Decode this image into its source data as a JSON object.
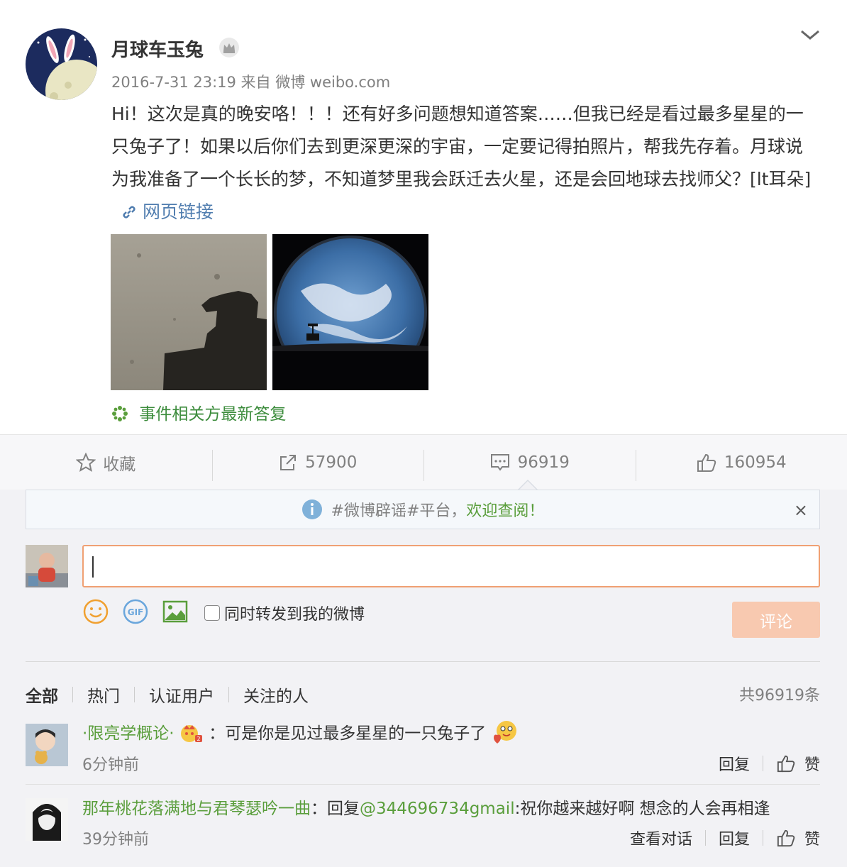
{
  "post": {
    "author": "月球车玉兔",
    "meta": "2016-7-31 23:19 来自 微博 weibo.com",
    "text": "Hi！这次是真的晚安咯！！！还有好多问题想知道答案……但我已经是看过最多星星的一只兔子了！如果以后你们去到更深更深的宇宙，一定要记得拍照片，帮我先存着。月球说为我准备了一个长长的梦，不知道梦里我会跃迁去火星，还是会回地球去找师父？[lt耳朵]",
    "link_label": "网页链接",
    "event_label": "事件相关方最新答复"
  },
  "actions": {
    "favorite": "收藏",
    "repost": "57900",
    "comment": "96919",
    "like": "160954"
  },
  "notice": {
    "head": "#微博辟谣#平台，",
    "tail": "欢迎查阅！",
    "close": "×"
  },
  "compose": {
    "sync_label": "同时转发到我的微博",
    "submit": "评论"
  },
  "tabs": [
    "全部",
    "热门",
    "认证用户",
    "关注的人"
  ],
  "total": "共96919条",
  "comments": [
    {
      "user": "·限亮学概论·",
      "text": "：可是你是见过最多星星的一只兔子了",
      "time": "6分钟前",
      "reply": "回复",
      "like": "赞"
    },
    {
      "user": "那年桃花落满地与君琴瑟吟一曲",
      "prefix": "：回复",
      "mention": "@344696734gmail",
      "text": ":祝你越来越好啊 想念的人会再相逢",
      "time": "39分钟前",
      "view": "查看对话",
      "reply": "回复",
      "like": "赞"
    }
  ]
}
